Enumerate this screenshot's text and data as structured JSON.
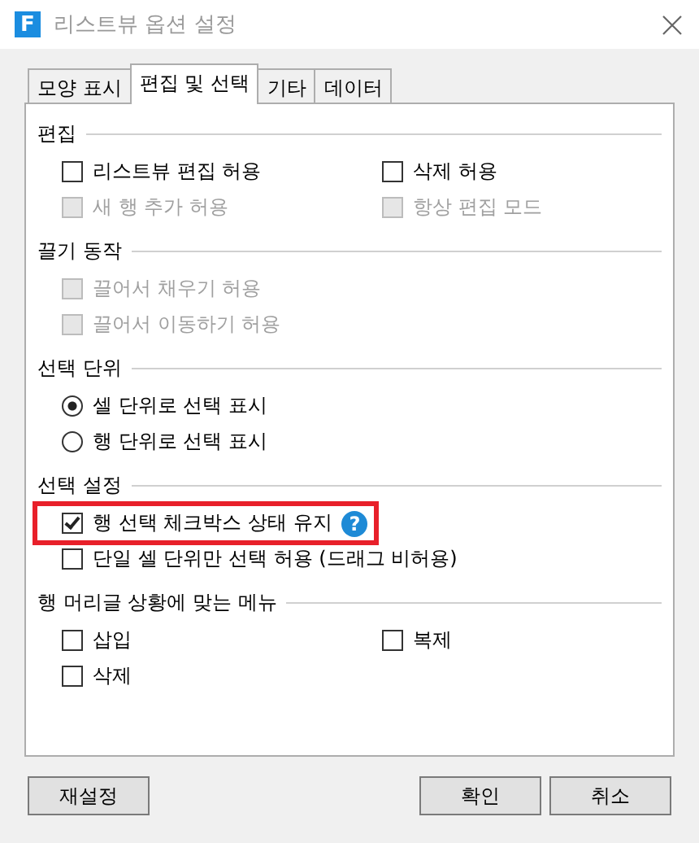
{
  "window": {
    "logo": "F",
    "title": "리스트뷰 옵션 설정"
  },
  "tabs": [
    {
      "label": "모양 표시",
      "selected": false
    },
    {
      "label": "편집 및 선택",
      "selected": true
    },
    {
      "label": "기타",
      "selected": false
    },
    {
      "label": "데이터",
      "selected": false
    }
  ],
  "sections": [
    {
      "title": "편집",
      "rows": [
        [
          {
            "kind": "checkbox",
            "label": "리스트뷰 편집 허용",
            "checked": false,
            "disabled": false
          },
          {
            "kind": "checkbox",
            "label": "삭제 허용",
            "checked": false,
            "disabled": false
          }
        ],
        [
          {
            "kind": "checkbox",
            "label": "새 행 추가 허용",
            "checked": false,
            "disabled": true
          },
          {
            "kind": "checkbox",
            "label": "항상 편집 모드",
            "checked": false,
            "disabled": true
          }
        ]
      ]
    },
    {
      "title": "끌기 동작",
      "rows": [
        [
          {
            "kind": "checkbox",
            "label": "끌어서 채우기 허용",
            "checked": false,
            "disabled": true
          }
        ],
        [
          {
            "kind": "checkbox",
            "label": "끌어서 이동하기 허용",
            "checked": false,
            "disabled": true
          }
        ]
      ]
    },
    {
      "title": "선택 단위",
      "rows": [
        [
          {
            "kind": "radio",
            "label": "셀 단위로 선택 표시",
            "selected": true,
            "disabled": false
          }
        ],
        [
          {
            "kind": "radio",
            "label": "행 단위로 선택 표시",
            "selected": false,
            "disabled": false
          }
        ]
      ]
    },
    {
      "title": "선택 설정",
      "rows": [
        [
          {
            "kind": "checkbox",
            "label": "행 선택 체크박스 상태 유지",
            "checked": true,
            "disabled": false,
            "highlighted": true,
            "help": "?"
          }
        ],
        [
          {
            "kind": "checkbox",
            "label": "단일 셀 단위만 선택 허용 (드래그 비허용)",
            "checked": false,
            "disabled": false,
            "highlighted": false
          }
        ]
      ]
    },
    {
      "title": "행 머리글 상황에 맞는 메뉴",
      "rows": [
        [
          {
            "kind": "checkbox",
            "label": "삽입",
            "checked": false,
            "disabled": false
          },
          {
            "kind": "checkbox",
            "label": "복제",
            "checked": false,
            "disabled": false
          }
        ],
        [
          {
            "kind": "checkbox",
            "label": "삭제",
            "checked": false,
            "disabled": false
          }
        ]
      ]
    }
  ],
  "buttons": {
    "left": [
      "재설정"
    ],
    "right": [
      "확인",
      "취소"
    ]
  }
}
